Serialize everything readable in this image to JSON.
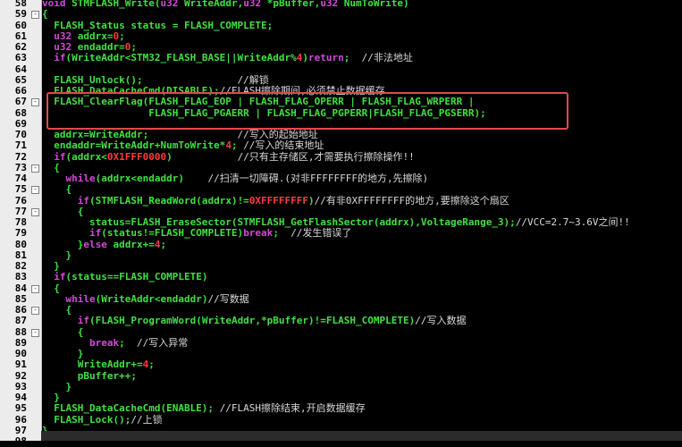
{
  "editor": {
    "language": "C",
    "highlight_color": "#e04a4a"
  },
  "colors": {
    "code": "#3fe23f",
    "keyword": "#d24ad8",
    "number": "#ff3b3b",
    "comment": "#d8d8d8",
    "background": "#000000"
  },
  "lines": [
    {
      "n": "58",
      "t": "void STMFLASH_Write(u32 WriteAddr,u32 *pBuffer,u32 NumToWrite)",
      "fold": ""
    },
    {
      "n": "59",
      "t": "{",
      "fold": "-"
    },
    {
      "n": "60",
      "t": "  FLASH_Status status = FLASH_COMPLETE;",
      "fold": ""
    },
    {
      "n": "61",
      "t": "  u32 addrx=0;",
      "fold": ""
    },
    {
      "n": "62",
      "t": "  u32 endaddr=0;",
      "fold": ""
    },
    {
      "n": "63",
      "t": "  if(WriteAddr<STM32_FLASH_BASE||WriteAddr%4)return;  //非法地址",
      "fold": ""
    },
    {
      "n": "64",
      "t": "",
      "fold": ""
    },
    {
      "n": "65",
      "t": "  FLASH_Unlock();                //解锁",
      "fold": ""
    },
    {
      "n": "66",
      "t": "  FLASH_DataCacheCmd(DISABLE);//FLASH擦除期间,必须禁止数据缓存",
      "fold": ""
    },
    {
      "n": "67",
      "t": "  FLASH_ClearFlag(FLASH_FLAG_EOP | FLASH_FLAG_OPERR | FLASH_FLAG_WRPERR |",
      "fold": "-"
    },
    {
      "n": "68",
      "t": "                  FLASH_FLAG_PGAERR | FLASH_FLAG_PGPERR|FLASH_FLAG_PGSERR);",
      "fold": ""
    },
    {
      "n": "69",
      "t": "",
      "fold": ""
    },
    {
      "n": "70",
      "t": "  addrx=WriteAddr;               //写入的起始地址",
      "fold": ""
    },
    {
      "n": "71",
      "t": "  endaddr=WriteAddr+NumToWrite*4; //写入的结束地址",
      "fold": ""
    },
    {
      "n": "72",
      "t": "  if(addrx<0X1FFF0000)           //只有主存储区,才需要执行擦除操作!!",
      "fold": ""
    },
    {
      "n": "73",
      "t": "  {",
      "fold": "-"
    },
    {
      "n": "74",
      "t": "    while(addrx<endaddr)    //扫清一切障碍.(对非FFFFFFFF的地方,先擦除)",
      "fold": ""
    },
    {
      "n": "75",
      "t": "    {",
      "fold": "-"
    },
    {
      "n": "76",
      "t": "      if(STMFLASH_ReadWord(addrx)!=0XFFFFFFFF)//有非0XFFFFFFFF的地方,要擦除这个扇区",
      "fold": ""
    },
    {
      "n": "77",
      "t": "      {",
      "fold": "-"
    },
    {
      "n": "78",
      "t": "        status=FLASH_EraseSector(STMFLASH_GetFlashSector(addrx),VoltageRange_3);//VCC=2.7~3.6V之间!!",
      "fold": ""
    },
    {
      "n": "79",
      "t": "        if(status!=FLASH_COMPLETE)break;  //发生错误了",
      "fold": ""
    },
    {
      "n": "80",
      "t": "      }else addrx+=4;",
      "fold": ""
    },
    {
      "n": "81",
      "t": "    }",
      "fold": ""
    },
    {
      "n": "82",
      "t": "  }",
      "fold": ""
    },
    {
      "n": "83",
      "t": "  if(status==FLASH_COMPLETE)",
      "fold": ""
    },
    {
      "n": "84",
      "t": "  {",
      "fold": "-"
    },
    {
      "n": "85",
      "t": "    while(WriteAddr<endaddr)//写数据",
      "fold": ""
    },
    {
      "n": "86",
      "t": "    {",
      "fold": "-"
    },
    {
      "n": "87",
      "t": "      if(FLASH_ProgramWord(WriteAddr,*pBuffer)!=FLASH_COMPLETE)//写入数据",
      "fold": ""
    },
    {
      "n": "88",
      "t": "      {",
      "fold": "-"
    },
    {
      "n": "89",
      "t": "        break;  //写入异常",
      "fold": ""
    },
    {
      "n": "90",
      "t": "      }",
      "fold": ""
    },
    {
      "n": "91",
      "t": "      WriteAddr+=4;",
      "fold": ""
    },
    {
      "n": "92",
      "t": "      pBuffer++;",
      "fold": ""
    },
    {
      "n": "93",
      "t": "    }",
      "fold": ""
    },
    {
      "n": "94",
      "t": "  }",
      "fold": ""
    },
    {
      "n": "95",
      "t": "  FLASH_DataCacheCmd(ENABLE); //FLASH擦除结束,开启数据缓存",
      "fold": ""
    },
    {
      "n": "96",
      "t": "  FLASH_Lock();//上锁",
      "fold": ""
    },
    {
      "n": "97",
      "t": "}",
      "fold": ""
    },
    {
      "n": "98",
      "t": "",
      "fold": ""
    }
  ]
}
